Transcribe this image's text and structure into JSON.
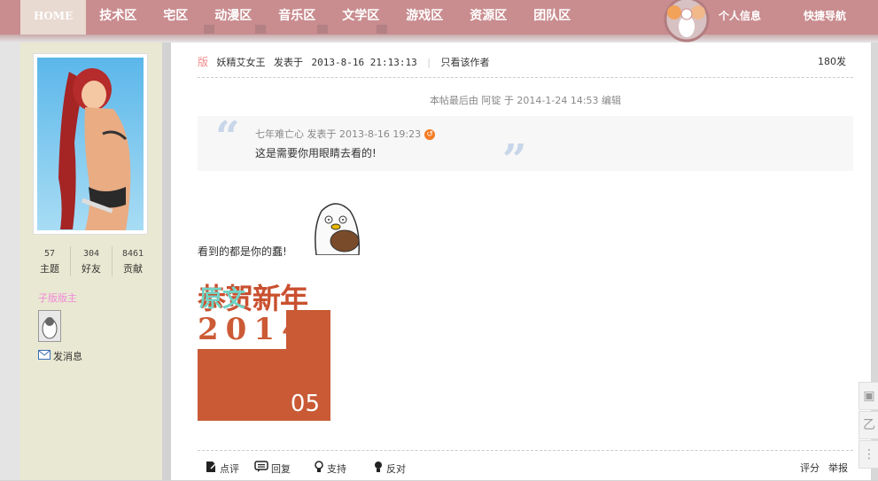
{
  "nav": {
    "home": "HOME",
    "items": [
      "技术区",
      "宅区",
      "动漫区",
      "音乐区",
      "文学区",
      "游戏区",
      "资源区",
      "团队区"
    ],
    "profile": "个人信息",
    "quicknav": "快捷导航"
  },
  "user": {
    "stats": [
      {
        "num": "57",
        "label": "主题"
      },
      {
        "num": "304",
        "label": "好友"
      },
      {
        "num": "8461",
        "label": "贡献"
      }
    ],
    "rank": "子版版主",
    "send_message": "发消息"
  },
  "post": {
    "badge": "版",
    "author": "妖精艾女王",
    "posted_prefix": "发表于",
    "posted_time": "2013-8-16 21:13:13",
    "only_author": "只看该作者",
    "floor": "180发",
    "edit_note": "本帖最后由 阿锭 于 2014-1-24 14:53 编辑",
    "quote_meta": "七年难亡心 发表于 2013-8-16 19:23",
    "quote_text": "这是需要你用眼睛去看的!",
    "body": "看到的都是你的蠢!",
    "card_title": "恭贺新年",
    "card_overlay": "原文",
    "card_year": "2014",
    "card_num": "05"
  },
  "actions": {
    "comment": "点评",
    "reply": "回复",
    "support": "支持",
    "oppose": "反对",
    "rate": "评分",
    "report": "举报"
  },
  "colors": {
    "topbar": "#c98c8f",
    "sidebar": "#e9e8d2",
    "rank": "#f08ad8",
    "quote_mark": "#c8d6ea"
  }
}
